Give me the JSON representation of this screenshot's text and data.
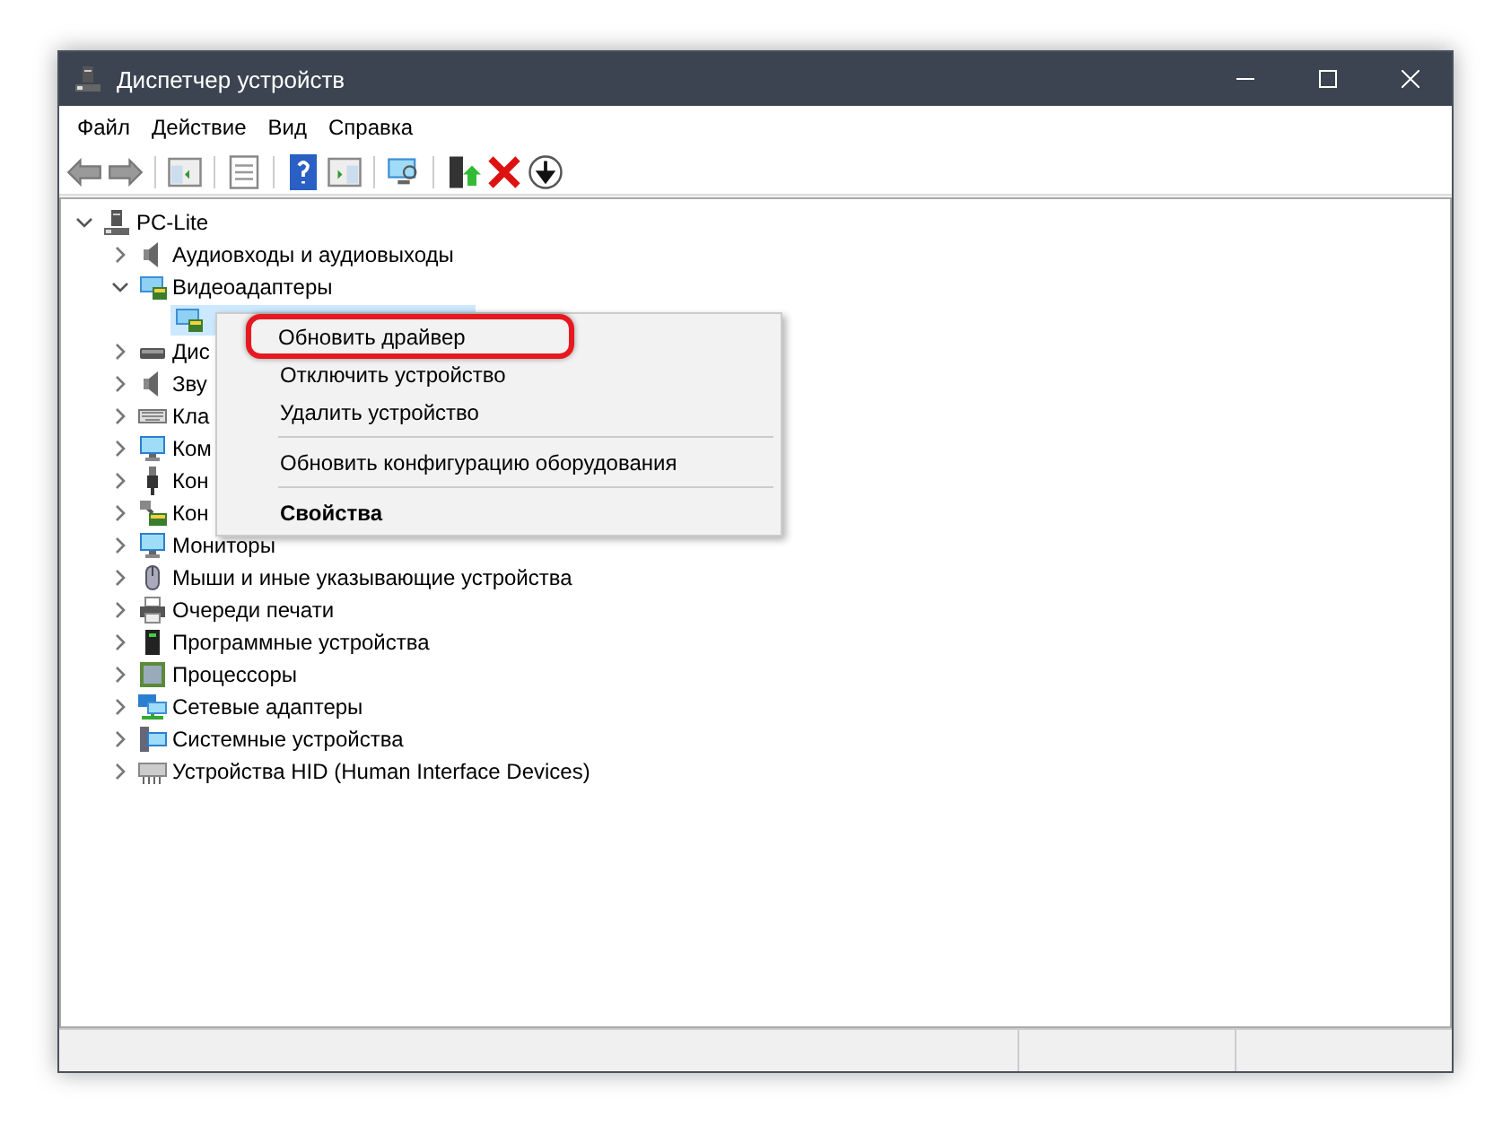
{
  "window": {
    "title": "Диспетчер устройств"
  },
  "menu_bar": [
    "Файл",
    "Действие",
    "Вид",
    "Справка"
  ],
  "tree": {
    "label": "PC-Lite",
    "kind": "computer",
    "expanded": true,
    "children": [
      {
        "label": "Аудиовходы и аудиовыходы",
        "kind": "audio",
        "expanded": false,
        "selected": false
      },
      {
        "label": "Видеоадаптеры",
        "kind": "display",
        "expanded": true,
        "selected": false,
        "children": [
          {
            "kind": "display",
            "selected": true
          }
        ]
      },
      {
        "label": "Дис",
        "kind": "disk",
        "expanded": false,
        "selected": false
      },
      {
        "label": "Зву",
        "kind": "audio",
        "expanded": false,
        "selected": false
      },
      {
        "label": "Кла",
        "kind": "keyboard",
        "expanded": false,
        "selected": false
      },
      {
        "label": "Ком",
        "kind": "monitor",
        "expanded": false,
        "selected": false
      },
      {
        "label": "Кон",
        "kind": "usb",
        "expanded": false,
        "selected": false
      },
      {
        "label": "Кон",
        "kind": "storage",
        "expanded": false,
        "selected": false
      },
      {
        "label": "Мониторы",
        "kind": "monitor",
        "expanded": false,
        "selected": false
      },
      {
        "label": "Мыши и иные указывающие устройства",
        "kind": "mouse",
        "expanded": false,
        "selected": false
      },
      {
        "label": "Очереди печати",
        "kind": "printer",
        "expanded": false,
        "selected": false
      },
      {
        "label": "Программные устройства",
        "kind": "firmware",
        "expanded": false,
        "selected": false
      },
      {
        "label": "Процессоры",
        "kind": "cpu",
        "expanded": false,
        "selected": false
      },
      {
        "label": "Сетевые адаптеры",
        "kind": "network",
        "expanded": false,
        "selected": false
      },
      {
        "label": "Системные устройства",
        "kind": "system",
        "expanded": false,
        "selected": false
      },
      {
        "label": "Устройства HID (Human Interface Devices)",
        "kind": "hid",
        "expanded": false,
        "selected": false
      }
    ]
  },
  "context_menu": [
    {
      "kind": "item",
      "label": "Обновить драйвер",
      "default": false,
      "circled": true
    },
    {
      "kind": "item",
      "label": "Отключить устройство",
      "default": false,
      "circled": false
    },
    {
      "kind": "item",
      "label": "Удалить устройство",
      "default": false,
      "circled": false
    },
    {
      "kind": "separator"
    },
    {
      "kind": "item",
      "label": "Обновить конфигурацию оборудования",
      "default": false,
      "circled": false
    },
    {
      "kind": "separator"
    },
    {
      "kind": "item",
      "label": "Свойства",
      "default": true,
      "circled": false
    }
  ]
}
